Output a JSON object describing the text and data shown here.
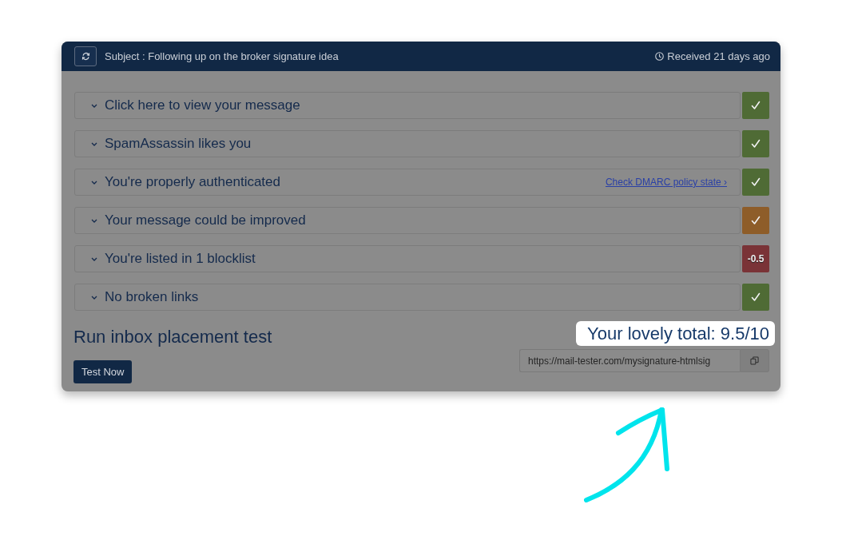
{
  "header": {
    "subject": "Subject : Following up on the broker signature idea",
    "received": "Received 21 days ago"
  },
  "checks": [
    {
      "label": "Click here to view your message",
      "kind": "check",
      "color": "#4f6b35"
    },
    {
      "label": "SpamAssassin likes you",
      "kind": "check",
      "color": "#4f6b35"
    },
    {
      "label": "You're properly authenticated",
      "kind": "check",
      "color": "#4f6b35",
      "link": "Check DMARC policy state ›"
    },
    {
      "label": "Your message could be improved",
      "kind": "check",
      "color": "#8e5d29"
    },
    {
      "label": "You're listed in 1 blocklist",
      "kind": "score",
      "score": "-0.5",
      "color": "#7a3337"
    },
    {
      "label": "No broken links",
      "kind": "check",
      "color": "#4f6b35"
    }
  ],
  "placement": {
    "title": "Run inbox placement test",
    "button": "Test Now"
  },
  "result": {
    "total": "Your lovely total: 9.5/10",
    "share_url": "https://mail-tester.com/mysignature-htmlsig"
  }
}
